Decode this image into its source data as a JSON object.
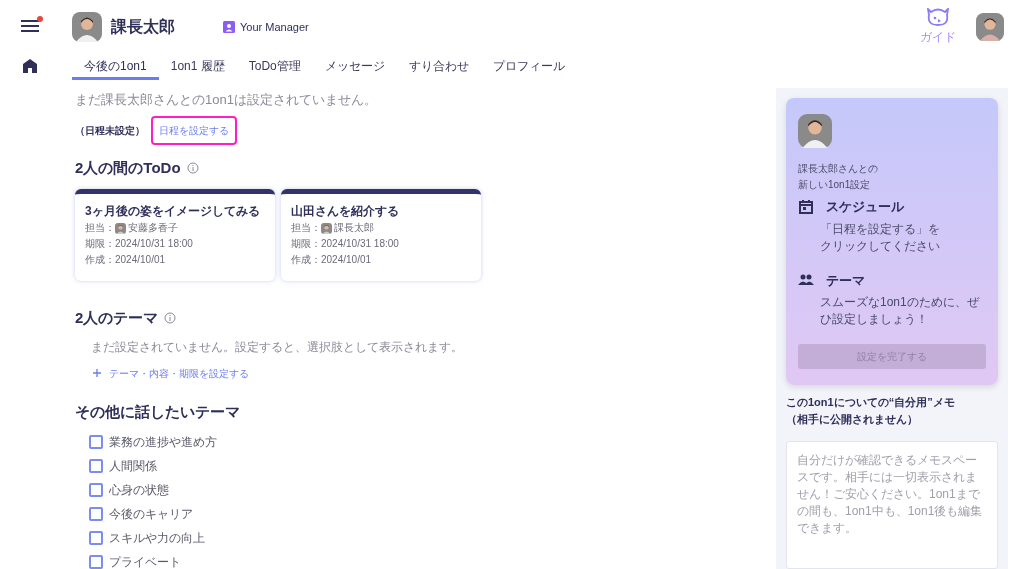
{
  "header": {
    "has_notification": true,
    "user_name": "課長太郎",
    "role": "Your Manager",
    "guide_label": "ガイド"
  },
  "tabs": [
    {
      "label": "今後の1on1",
      "selected": true
    },
    {
      "label": "1on1 履歴",
      "selected": false
    },
    {
      "label": "ToDo管理",
      "selected": false
    },
    {
      "label": "メッセージ",
      "selected": false
    },
    {
      "label": "すり合わせ",
      "selected": false
    },
    {
      "label": "プロフィール",
      "selected": false
    }
  ],
  "notice": "まだ課長太郎さんとの1on1は設定されていません。",
  "schedule": {
    "status": "（日程未設定）",
    "link": "日程を設定する",
    "highlighted": true
  },
  "todo": {
    "title": "2人の間のToDo",
    "cards": [
      {
        "title": "3ヶ月後の姿をイメージしてみる",
        "assignee_label": "担当：",
        "assignee": "安藤多香子",
        "due": "期限：2024/10/31 18:00",
        "created": "作成：2024/10/01"
      },
      {
        "title": "山田さんを紹介する",
        "assignee_label": "担当：",
        "assignee": "課長太郎",
        "due": "期限：2024/10/31 18:00",
        "created": "作成：2024/10/01"
      }
    ]
  },
  "themes": {
    "title": "2人のテーマ",
    "empty": "まだ設定されていません。設定すると、選択肢として表示されます。",
    "add_link": "テーマ・内容・期限を設定する"
  },
  "other_themes": {
    "title": "その他に話したいテーマ",
    "items": [
      {
        "label": "業務の進捗や進め方",
        "checked": false
      },
      {
        "label": "人間関係",
        "checked": false
      },
      {
        "label": "心身の状態",
        "checked": false
      },
      {
        "label": "今後のキャリア",
        "checked": false
      },
      {
        "label": "スキルや力の向上",
        "checked": false
      },
      {
        "label": "プライベート",
        "checked": false
      }
    ]
  },
  "setup_card": {
    "intro": [
      "課長太郎さんとの",
      "新しい1on1設定"
    ],
    "steps": [
      {
        "kind": "calendar",
        "title": "スケジュール",
        "text": [
          "「日程を設定する」を",
          "クリックしてください"
        ]
      },
      {
        "kind": "people",
        "title": "テーマ",
        "text": [
          "スムーズな1on1のために、ぜ",
          "ひ設定しましょう！"
        ]
      }
    ],
    "button": "設定を完了する",
    "button_disabled": true
  },
  "memo": {
    "title": [
      "この1on1についての“自分用”メモ",
      "（相手に公開されません）"
    ],
    "placeholder": "自分だけが確認できるメモスペースです。相手には一切表示されません！ご安心ください。1on1までの間も、1on1中も、1on1後も編集できます。"
  }
}
